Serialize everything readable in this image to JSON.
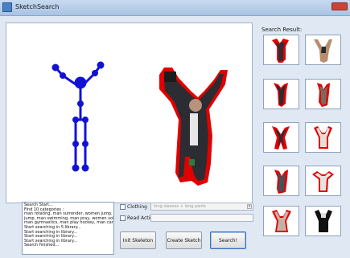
{
  "window": {
    "title": "SketchSearch"
  },
  "results": {
    "label": "Search Result:"
  },
  "log": {
    "lines": [
      "Search Start...",
      "Find 10 categories :",
      "man rotating, man surrender, women jump, man",
      "jump, man swimming, man pray, women volleyball,",
      "man gymnastics, man play hockey, man carry papers",
      "Start searching in 5 library...",
      "Start searching in library...",
      "Start searching in library...",
      "Start searching in library...",
      "Search finished..."
    ]
  },
  "options": {
    "clothing_label": "Clothing",
    "clothing_placeholder": "long sleeves + long pants",
    "read_action_label": "Read Action"
  },
  "buttons": {
    "init_label": "Init Skeleton",
    "create_label": "Create Sketch",
    "search_label": "Search!"
  },
  "colors": {
    "skeleton": "#1212d4",
    "silhouette_outline": "#e00000"
  }
}
